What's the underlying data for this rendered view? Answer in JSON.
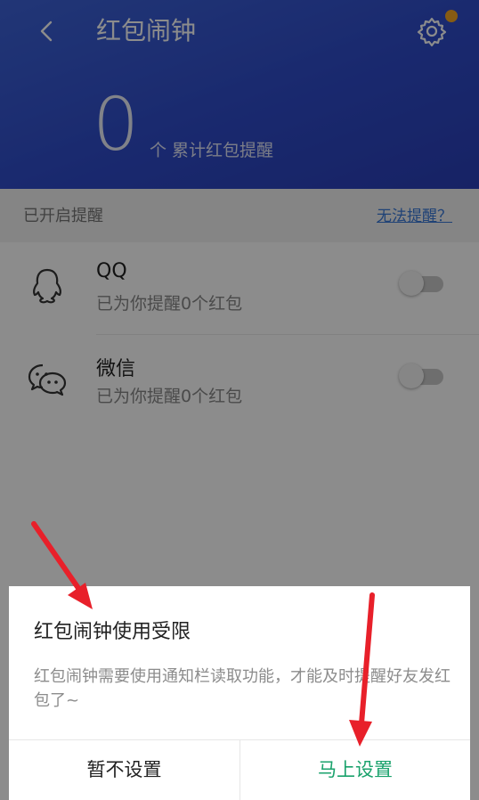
{
  "header": {
    "title": "红包闹钟",
    "count": "0",
    "count_label": "个 累计红包提醒"
  },
  "section": {
    "label": "已开启提醒",
    "help_link": "无法提醒？"
  },
  "rows": [
    {
      "title": "QQ",
      "subtitle": "已为你提醒0个红包",
      "icon": "qq-penguin-icon",
      "enabled": false
    },
    {
      "title": "微信",
      "subtitle": "已为你提醒0个红包",
      "icon": "wechat-icon",
      "enabled": false
    }
  ],
  "dialog": {
    "title": "红包闹钟使用受限",
    "message": "红包闹钟需要使用通知栏读取功能，才能及时提醒好友发红包了~",
    "cancel_label": "暂不设置",
    "ok_label": "马上设置"
  },
  "colors": {
    "header_blue": "#2f4bc9",
    "accent_green": "#1aa26c",
    "link_blue": "#3a78d8",
    "annotation_red": "#e8202a",
    "badge_orange": "#f5a623"
  }
}
